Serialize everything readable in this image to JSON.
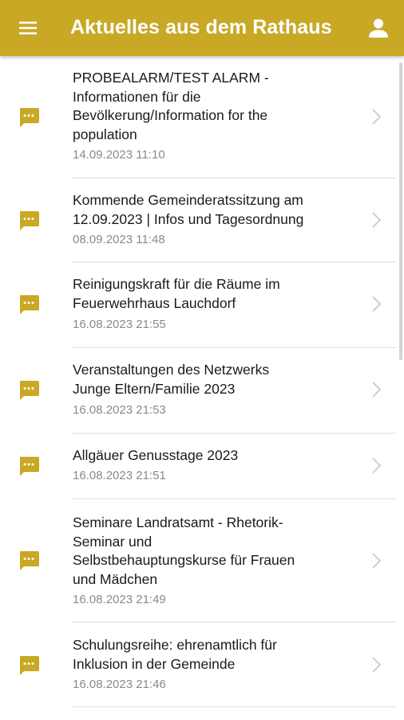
{
  "appbar": {
    "title": "Aktuelles aus dem Rathaus",
    "menu_icon": "hamburger-menu-icon",
    "profile_icon": "person-icon",
    "background_color": "#c9a826",
    "foreground_color": "#ffffff"
  },
  "list": {
    "item_icon": "chat-bubble-icon",
    "item_icon_color": "#c9a826",
    "chevron_icon": "chevron-right-icon",
    "items": [
      {
        "title_lines": [
          "PROBEALARM/TEST ALARM -",
          "Informationen für die",
          "Bevölkerung/Information for the",
          "population"
        ],
        "date": "14.09.2023 11:10"
      },
      {
        "title_lines": [
          "Kommende Gemeinderatssitzung am",
          "12.09.2023 | Infos und Tagesordnung"
        ],
        "date": "08.09.2023 11:48"
      },
      {
        "title_lines": [
          "Reinigungskraft für die Räume im",
          "Feuerwehrhaus Lauchdorf"
        ],
        "date": "16.08.2023 21:55"
      },
      {
        "title_lines": [
          "Veranstaltungen des Netzwerks",
          "Junge Eltern/Familie 2023"
        ],
        "date": "16.08.2023 21:53"
      },
      {
        "title_lines": [
          "Allgäuer Genusstage 2023"
        ],
        "date": "16.08.2023 21:51"
      },
      {
        "title_lines": [
          "Seminare Landratsamt - Rhetorik-",
          "Seminar und",
          "Selbstbehauptungskurse für Frauen",
          "und Mädchen"
        ],
        "date": "16.08.2023 21:49"
      },
      {
        "title_lines": [
          "Schulungsreihe: ehrenamtlich für",
          "Inklusion in der Gemeinde"
        ],
        "date": "16.08.2023 21:46"
      }
    ]
  }
}
